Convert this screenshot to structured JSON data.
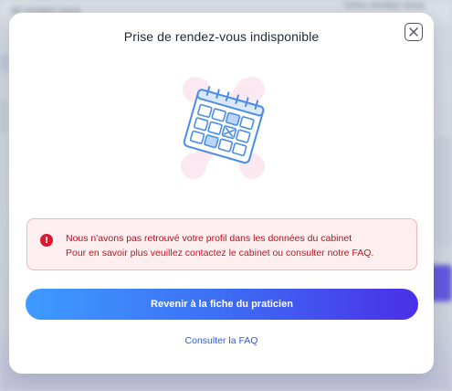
{
  "background": {
    "left_text": "de rendez-vous",
    "right_text": "Votre rendez-vous"
  },
  "modal": {
    "title": "Prise de rendez-vous indisponible",
    "close_icon": "close-icon",
    "illustration_icon": "calendar-icon",
    "alert": {
      "icon": "exclamation-icon",
      "icon_glyph": "!",
      "title": "Nous n'avons pas retrouvé votre profil dans les données du cabinet",
      "body": "Pour en savoir plus veuillez contactez le cabinet ou consulter notre FAQ."
    },
    "primary_button_label": "Revenir à la fiche du praticien",
    "faq_link_label": "Consulter la FAQ"
  },
  "colors": {
    "alert_bg": "#fdeef0",
    "alert_border": "#f2b4bc",
    "alert_text": "#c4141f",
    "button_gradient_start": "#3e9bff",
    "button_gradient_end": "#4a2fe8",
    "link": "#2d5bd8"
  }
}
